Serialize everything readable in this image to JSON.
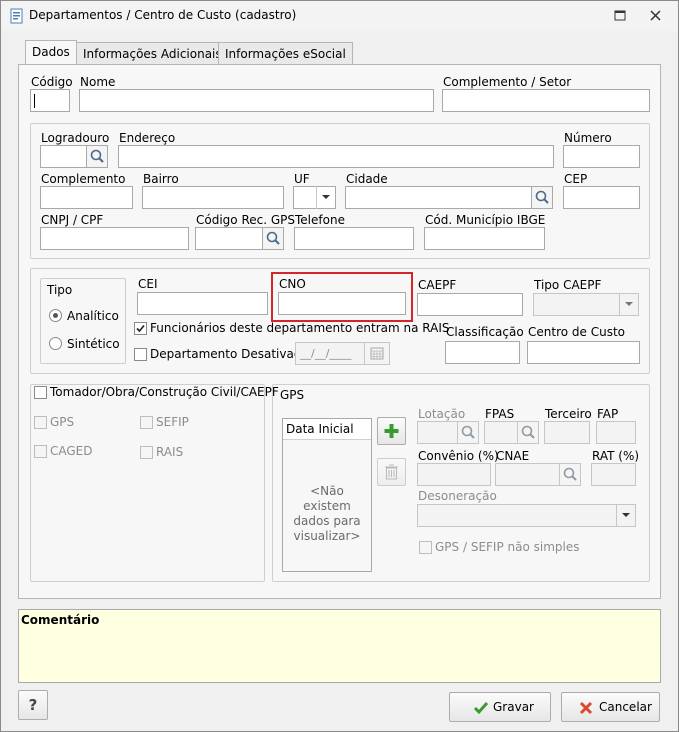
{
  "window": {
    "title": "Departamentos / Centro de Custo (cadastro)"
  },
  "tabs": [
    "Dados",
    "Informações Adicionais",
    "Informações eSocial"
  ],
  "fields": {
    "codigo": "Código",
    "nome": "Nome",
    "complemento_setor": "Complemento / Setor",
    "logradouro": "Logradouro",
    "endereco": "Endereço",
    "numero": "Número",
    "complemento": "Complemento",
    "bairro": "Bairro",
    "uf": "UF",
    "cidade": "Cidade",
    "cep": "CEP",
    "cnpj_cpf": "CNPJ / CPF",
    "codigo_rec_gps": "Código Rec. GPS",
    "telefone": "Telefone",
    "cod_municipio_ibge": "Cód. Município IBGE",
    "cei": "CEI",
    "cno": "CNO",
    "caepf": "CAEPF",
    "tipo_caepf": "Tipo CAEPF",
    "classificacao": "Classificação",
    "centro_de_custo": "Centro de Custo"
  },
  "tipo": {
    "title": "Tipo",
    "analitico": "Analítico",
    "sintetico": "Sintético",
    "selected": "Analítico"
  },
  "checks": {
    "funcionarios_rais": "Funcionários deste departamento entram na RAIS",
    "departamento_desativado": "Departamento Desativado",
    "date_placeholder": "__/__/____"
  },
  "tomador": {
    "title": "Tomador/Obra/Construção Civil/CAEPF",
    "gps": "GPS",
    "sefip": "SEFIP",
    "caged": "CAGED",
    "rais": "RAIS"
  },
  "gps": {
    "title": "GPS",
    "list_header": "Data Inicial",
    "empty": "<Não existem dados para visualizar>",
    "lotacao": "Lotação",
    "fpas": "FPAS",
    "terceiro": "Terceiro",
    "fap": "FAP",
    "convenio": "Convênio (%)",
    "cnae": "CNAE",
    "rat": "RAT (%)",
    "desoneracao": "Desoneração",
    "nao_simples": "GPS / SEFIP não simples"
  },
  "comentario": "Comentário",
  "buttons": {
    "help": "?",
    "gravar": "Gravar",
    "cancelar": "Cancelar"
  },
  "colors": {
    "highlight": "#d3262a",
    "comment_bg": "#ffffe1",
    "accent_green": "#3a9a2f",
    "cancel_red": "#d94a2c"
  }
}
